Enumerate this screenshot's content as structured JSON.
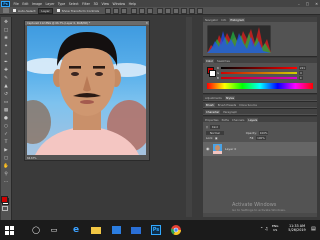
{
  "app": {
    "logo": "Ps"
  },
  "menu": [
    "File",
    "Edit",
    "Image",
    "Layer",
    "Type",
    "Select",
    "Filter",
    "3D",
    "View",
    "Window",
    "Help"
  ],
  "options_bar": {
    "auto_select_label": "Auto-Select:",
    "auto_select_value": "Layer",
    "transform_label": "Show Transform Controls"
  },
  "document": {
    "tab_title": "Capture0 112.PNG @ 66.7% (Layer 0, RGB/8#) *",
    "zoom": "66.67%"
  },
  "histogram_panel": {
    "tabs": [
      "Navigator",
      "Info",
      "Histogram"
    ],
    "active": "Histogram"
  },
  "color_panel": {
    "tabs": [
      "Color",
      "Swatches"
    ],
    "channels": [
      "R",
      "G",
      "B"
    ],
    "values": [
      "221",
      "0",
      "0"
    ]
  },
  "adjustments_panel": {
    "tabs": [
      "Adjustments",
      "Styles"
    ]
  },
  "brush_panel": {
    "tabs": [
      "Brush",
      "Brush Presets",
      "Clone Source"
    ]
  },
  "char_panel": {
    "tabs": [
      "Character",
      "Paragraph"
    ]
  },
  "layers_panel": {
    "tabs": [
      "Properties",
      "Paths",
      "Channels",
      "Layers"
    ],
    "active": "Layers",
    "kind_label": "Kind",
    "blend_mode": "Normal",
    "opacity_label": "Opacity:",
    "opacity_value": "100%",
    "lock_label": "Lock:",
    "fill_label": "Fill:",
    "fill_value": "100%",
    "layers": [
      {
        "name": "Layer 0"
      }
    ]
  },
  "watermark": {
    "title": "Activate Windows",
    "subtitle": "Go to Settings to activate Windows."
  },
  "taskbar": {
    "language": "ENG",
    "region": "US",
    "time": "11:33 AM",
    "date": "5/26/2019",
    "icons": [
      "windows-start",
      "search",
      "task-view",
      "edge",
      "file-explorer",
      "store",
      "mail",
      "photoshop",
      "chrome"
    ]
  },
  "colors": {
    "foreground": "#d00000",
    "background": "#ffffff",
    "accent": "#31a8ff"
  }
}
